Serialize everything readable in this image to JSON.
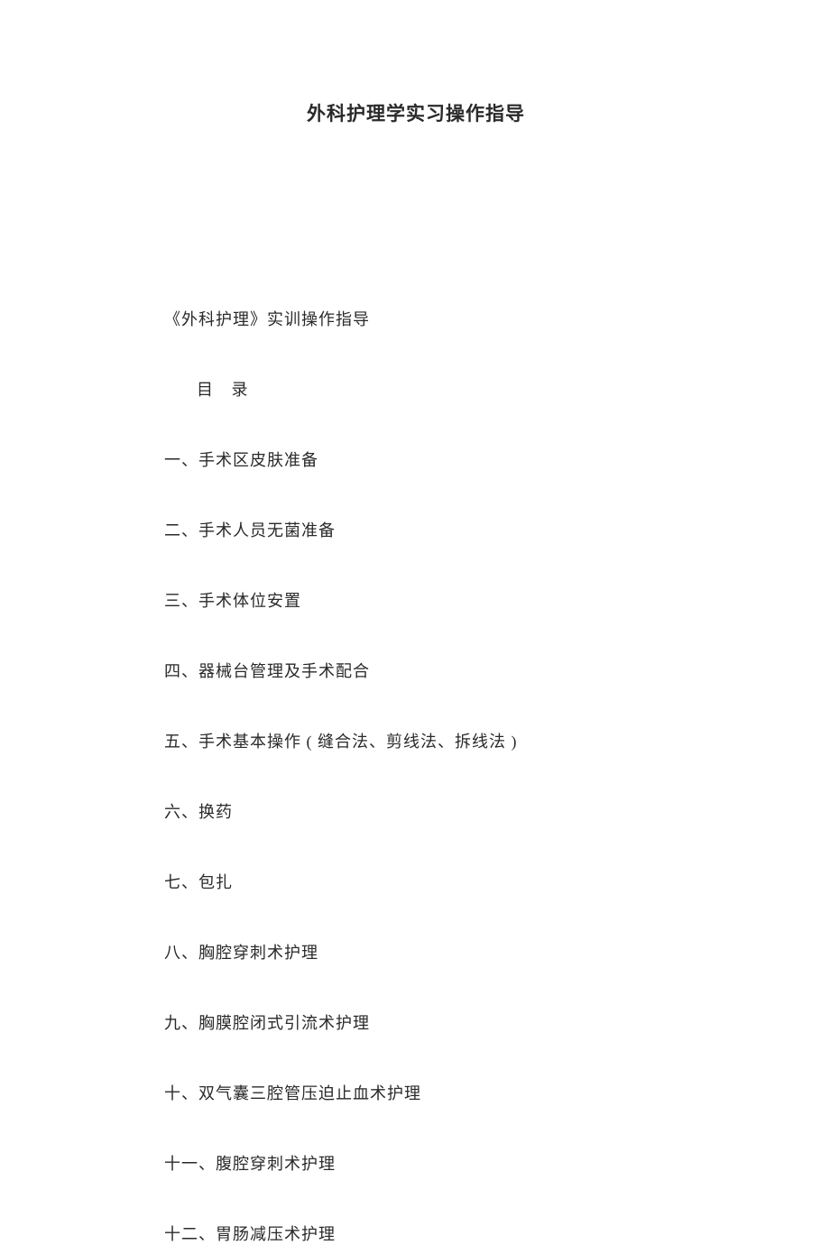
{
  "title": "外科护理学实习操作指导",
  "subtitle": "《外科护理》实训操作指导",
  "toc_heading": "目 录",
  "toc": [
    "一、手术区皮肤准备",
    "二、手术人员无菌准备",
    "三、手术体位安置",
    "四、器械台管理及手术配合",
    "五、手术基本操作 ( 缝合法、剪线法、拆线法    )",
    "六、换药",
    "七、包扎",
    "八、胸腔穿刺术护理",
    "九、胸膜腔闭式引流术护理",
    "十、双气囊三腔管压迫止血术护理",
    "十一、腹腔穿刺术护理",
    "十二、胃肠减压术护理"
  ]
}
